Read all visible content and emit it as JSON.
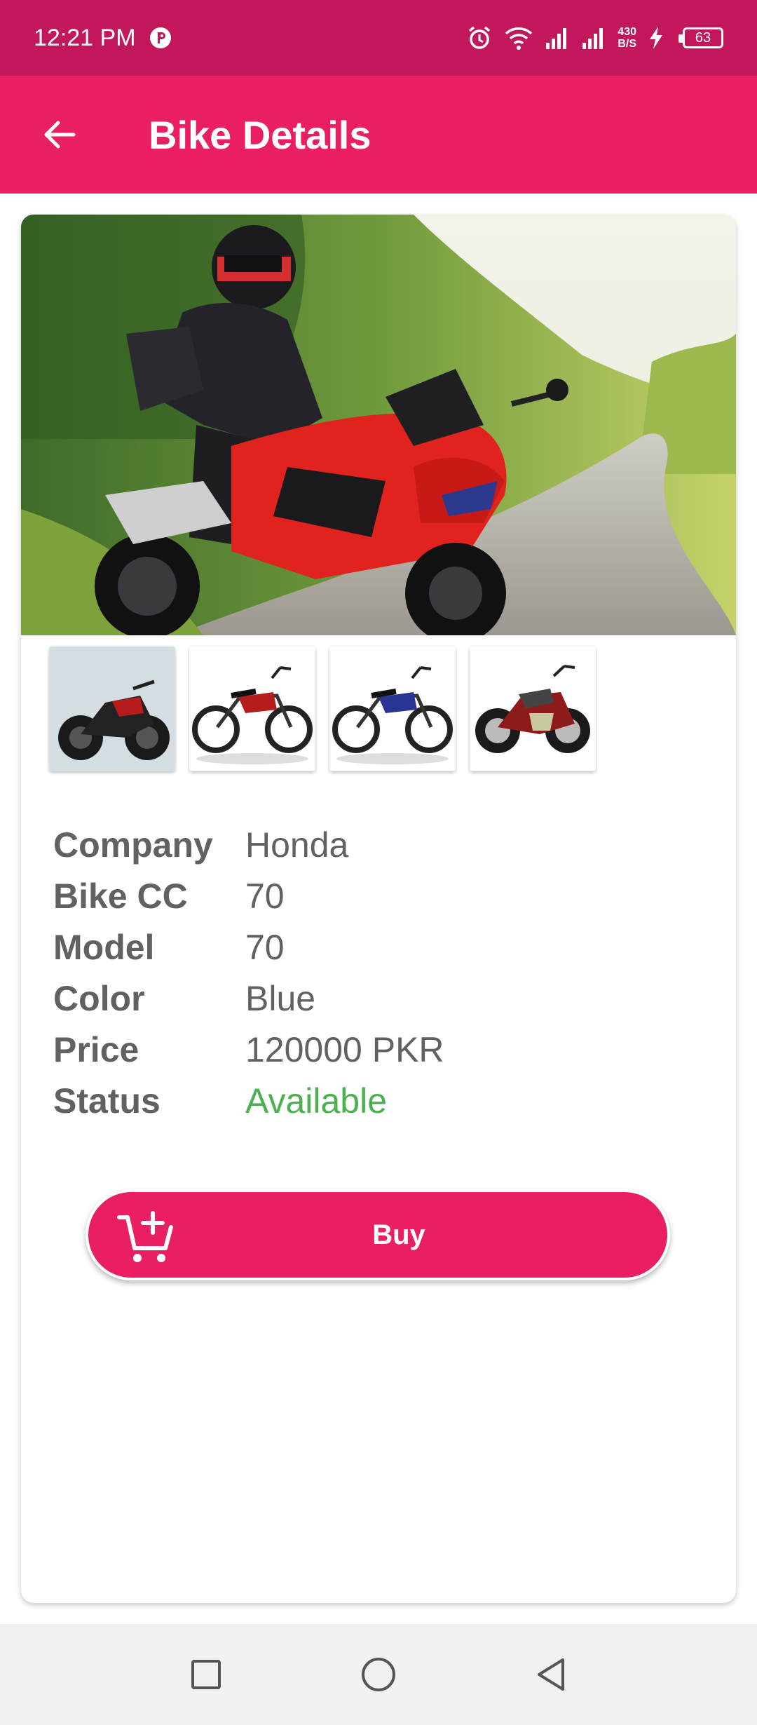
{
  "status_bar": {
    "time": "12:21 PM",
    "net_speed_value": "430",
    "net_speed_unit": "B/S",
    "battery": "63",
    "icons": [
      "app-notification-icon",
      "alarm-icon",
      "wifi-icon",
      "signal-icon",
      "signal-icon",
      "charging-icon",
      "battery-icon"
    ]
  },
  "app_bar": {
    "title": "Bike Details",
    "back_icon": "arrow-back-icon"
  },
  "details": {
    "rows": [
      {
        "label": "Company",
        "value": "Honda"
      },
      {
        "label": "Bike CC",
        "value": "70"
      },
      {
        "label": "Model",
        "value": "70"
      },
      {
        "label": "Color",
        "value": "Blue"
      },
      {
        "label": "Price",
        "value": "120000 PKR"
      },
      {
        "label": "Status",
        "value": "Available"
      }
    ]
  },
  "buy_button": {
    "label": "Buy",
    "icon": "add-shopping-cart-icon"
  },
  "nav_bar": {
    "icons": [
      "recents-square-icon",
      "home-circle-icon",
      "back-triangle-icon"
    ]
  },
  "colors": {
    "status_bar": "#c2185b",
    "primary": "#e91e63",
    "label_text": "#616161",
    "status_available": "#4caf50"
  }
}
